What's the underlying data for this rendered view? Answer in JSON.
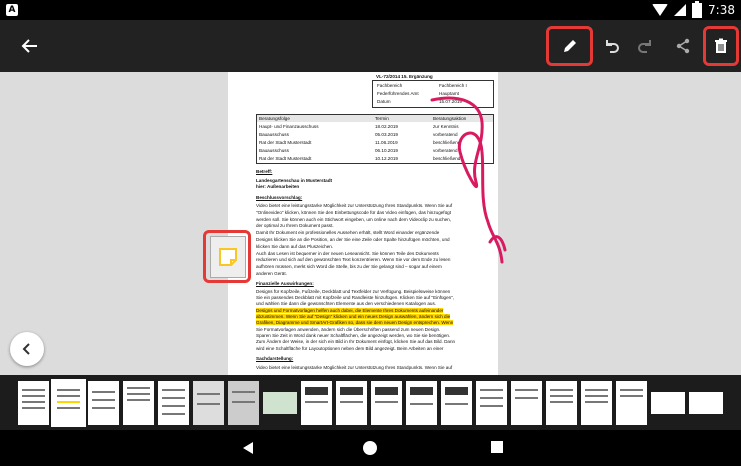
{
  "status": {
    "time": "7:38",
    "app_icon": "A"
  },
  "toolbar": {
    "back_icon": "arrow-left-icon",
    "actions": [
      "pen-icon",
      "undo-icon",
      "redo-icon",
      "share-icon",
      "trash-icon"
    ]
  },
  "document": {
    "ref": "VL-72/2014 15. Ergänzung",
    "meta_rows": [
      [
        "Fachbereich",
        "Fachbereich I"
      ],
      [
        "Federführendes Amt",
        "Hauptamt"
      ],
      [
        "Datum",
        "15.07.2019"
      ]
    ],
    "table_headers": [
      "Beratungsfolge",
      "Termin",
      "Beratungsaktion"
    ],
    "table_rows": [
      [
        "Haupt- und Finanzausschuss",
        "18.02.2019",
        "zur Kenntnis"
      ],
      [
        "Bauausschuss",
        "05.03.2019",
        "vorberatend"
      ],
      [
        "Rat der Stadt Musterstadt",
        "11.06.2019",
        "beschließend"
      ],
      [
        "Bauausschuss",
        "06.10.2019",
        "vorberatend"
      ],
      [
        "Rat der Stadt Musterstadt",
        "10.12.2019",
        "beschließend"
      ]
    ],
    "betreff_label": "Betreff:",
    "betreff_line1": "Landesgartenschau in Musterstadt",
    "betreff_line2": "hier: Außenarbeiten",
    "beschluss_label": "Beschlussvorschlag:",
    "beschluss_lines": [
      "Video bietet eine leistungsstarke Möglichkeit zur Unterstützung Ihres Standpunkts. Wenn Sie auf",
      "\"Onlinevideo\" klicken, können Sie den Einbettungscode für das Video einfügen, das hinzugefügt",
      "werden soll. Sie können auch ein Stichwort eingeben, um online nach dem Videoclip zu suchen,",
      "der optimal zu Ihrem Dokument passt.",
      "Damit Ihr Dokument ein professionelles Aussehen erhält, stellt Word einander ergänzende",
      "Designs klicken Sie an die Position, an der Sie eine Zeile oder Spalte hinzufügen möchten, und",
      "klicken Sie dann auf das Pluszeichen.",
      "Auch das Lesen ist bequemer in der neuen Leseansicht. Sie können Teile des Dokuments",
      "reduzieren und sich auf den gewünschten Text konzentrieren. Wenn Sie vor dem Ende zu lesen",
      "aufhören müssen, merkt sich Word die Stelle, bis zu der Sie gelangt sind – sogar auf einem",
      "anderen Gerät."
    ],
    "finanz_label": "Finanzielle Auswirkungen:",
    "finanz_lines": [
      "Designs für Kopfzeile, Fußzeile, Deckblatt und Textfelder zur Verfügung. Beispielsweise können",
      "Sie ein passendes Deckblatt mit Kopfzeile und Randleiste hinzufügen. Klicken Sie auf \"Einfügen\",",
      "und wählen Sie dann die gewünschten Elemente aus den verschiedenen Katalogen aus."
    ],
    "finanz_highlight": [
      "Designs und Formatvorlagen helfen auch dabei, die Elemente Ihres Dokuments aufeinander",
      "abzustimmen. Wenn Sie auf \"Design\" klicken und ein neues Design auswählen, ändern sich die",
      "Grafiken, Diagramme und SmartArt-Grafiken so, dass sie dem neuen Design entsprechen. Wenn"
    ],
    "finanz_after": [
      "Sie Formatvorlagen anwenden, ändern sich die Überschriften passend zum neuen Design.",
      "Sparen Sie Zeit in Word dank neuer Schaltflächen, die angezeigt werden, wo Sie sie benötigen.",
      "Zum Ändern der Weise, in der sich ein Bild in Ihr Dokument einfügt, klicken Sie auf das Bild. Dann",
      "wird eine Schaltfläche für Layoutoptionen neben dem Bild angezeigt. Beim Arbeiten an einer"
    ],
    "sach_label": "Sachdarstellung:",
    "sach_line": "Video bietet eine leistungsstarke Möglichkeit zur Unterstützung Ihres Standpunkts. Wenn Sie auf"
  },
  "colors": {
    "highlight": "#e53935",
    "ink": "#d81b60",
    "note": "#fdd835"
  },
  "nav": {
    "back": "back-triangle-icon",
    "home": "home-circle-icon",
    "recents": "recents-square-icon"
  }
}
